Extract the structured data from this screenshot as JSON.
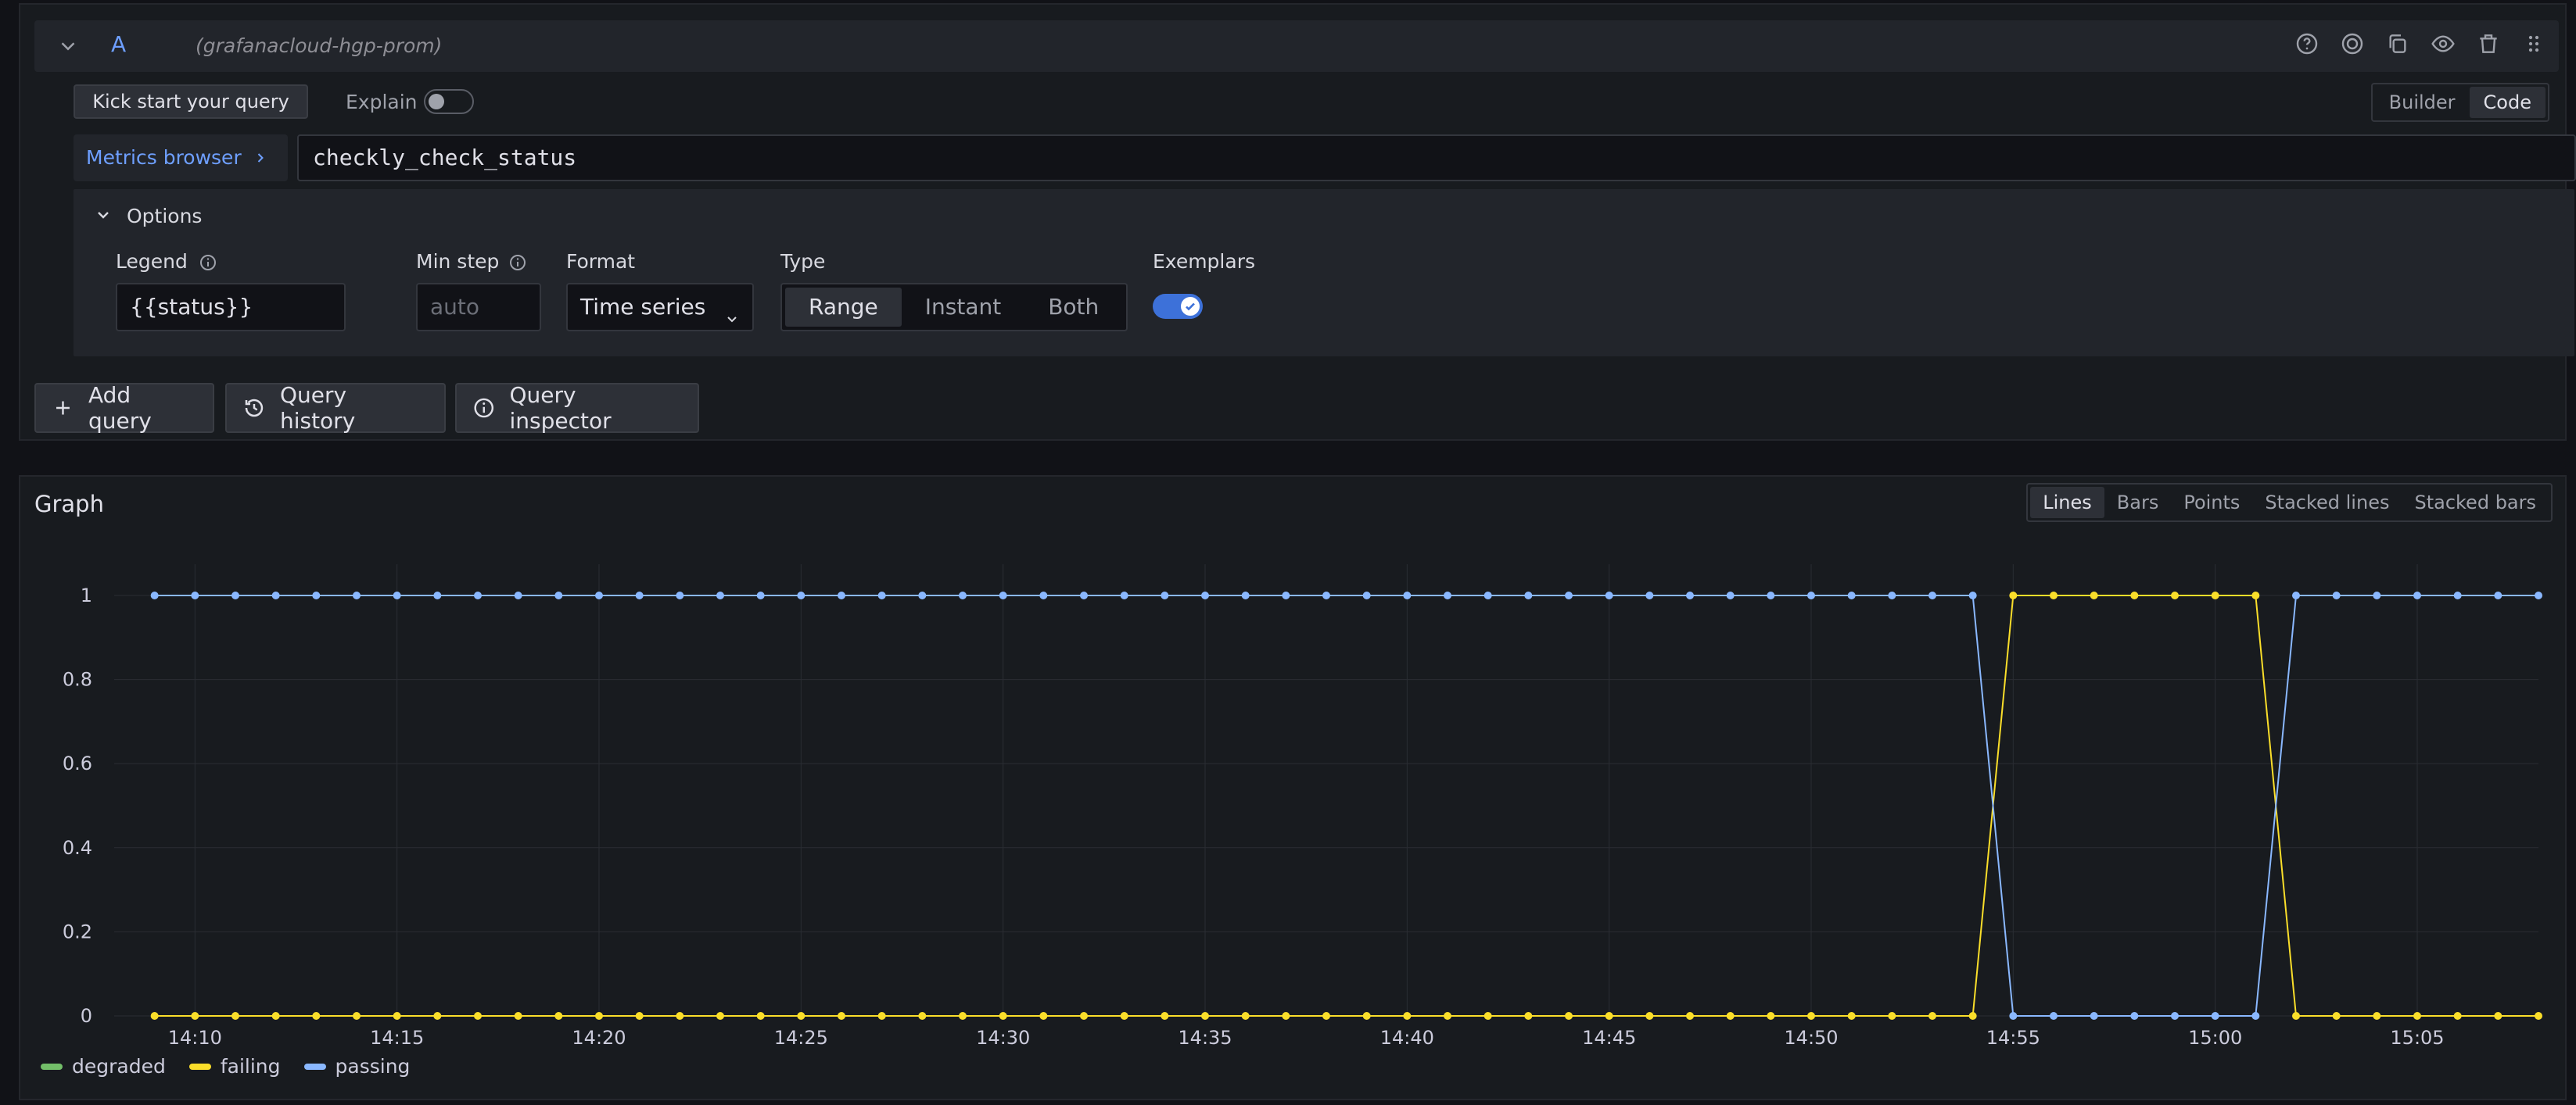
{
  "query": {
    "letter": "A",
    "datasource": "(grafanacloud-hgp-prom)",
    "kick_start_label": "Kick start your query",
    "explain_label": "Explain",
    "mode_builder": "Builder",
    "mode_code": "Code",
    "active_mode": "Code",
    "metrics_browser_label": "Metrics browser",
    "expression": "checkly_check_status",
    "header_icons": [
      "help-icon",
      "target-icon",
      "copy-icon",
      "eye-icon",
      "trash-icon",
      "drag-handle-icon"
    ],
    "options": {
      "title": "Options",
      "legend_label": "Legend",
      "legend_value": "{{status}}",
      "min_step_label": "Min step",
      "min_step_placeholder": "auto",
      "format_label": "Format",
      "format_value": "Time series",
      "type_label": "Type",
      "type_options": [
        "Range",
        "Instant",
        "Both"
      ],
      "type_selected": "Range",
      "exemplars_label": "Exemplars",
      "exemplars_enabled": true
    }
  },
  "actions": {
    "add_query": "Add query",
    "query_history": "Query history",
    "query_inspector": "Query inspector"
  },
  "graph": {
    "title": "Graph",
    "vis_options": [
      "Lines",
      "Bars",
      "Points",
      "Stacked lines",
      "Stacked bars"
    ],
    "vis_selected": "Lines"
  },
  "colors": {
    "degraded": "#73bf69",
    "failing": "#fade2a",
    "passing": "#8ab8ff",
    "accent": "#6e9fff"
  },
  "chart_data": {
    "type": "line",
    "title": "",
    "xlabel": "",
    "ylabel": "",
    "ylim": [
      0,
      1
    ],
    "yticks": [
      "0",
      "0.2",
      "0.4",
      "0.6",
      "0.8",
      "1"
    ],
    "xticks": [
      "14:10",
      "14:15",
      "14:20",
      "14:25",
      "14:30",
      "14:35",
      "14:40",
      "14:45",
      "14:50",
      "14:55",
      "15:00",
      "15:05"
    ],
    "x_start": "14:09",
    "x_end": "15:08",
    "step_minutes": 1,
    "grid": true,
    "legend_position": "bottom-left",
    "series": [
      {
        "name": "degraded",
        "values": []
      },
      {
        "name": "failing",
        "values": [
          0,
          0,
          0,
          0,
          0,
          0,
          0,
          0,
          0,
          0,
          0,
          0,
          0,
          0,
          0,
          0,
          0,
          0,
          0,
          0,
          0,
          0,
          0,
          0,
          0,
          0,
          0,
          0,
          0,
          0,
          0,
          0,
          0,
          0,
          0,
          0,
          0,
          0,
          0,
          0,
          0,
          0,
          0,
          0,
          0,
          0,
          1,
          1,
          1,
          1,
          1,
          1,
          1,
          0,
          0,
          0,
          0,
          0,
          0,
          0
        ]
      },
      {
        "name": "passing",
        "values": [
          1,
          1,
          1,
          1,
          1,
          1,
          1,
          1,
          1,
          1,
          1,
          1,
          1,
          1,
          1,
          1,
          1,
          1,
          1,
          1,
          1,
          1,
          1,
          1,
          1,
          1,
          1,
          1,
          1,
          1,
          1,
          1,
          1,
          1,
          1,
          1,
          1,
          1,
          1,
          1,
          1,
          1,
          1,
          1,
          1,
          1,
          0,
          0,
          0,
          0,
          0,
          0,
          0,
          1,
          1,
          1,
          1,
          1,
          1,
          1
        ]
      }
    ]
  }
}
